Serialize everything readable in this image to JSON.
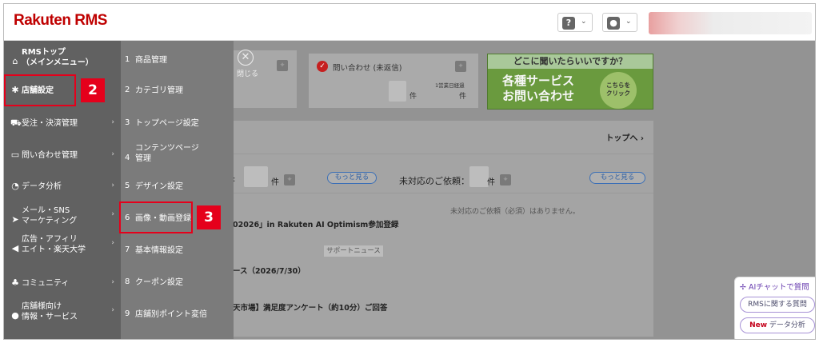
{
  "header": {
    "logo": "Rakuten RMS",
    "help_icon": "?",
    "user_icon": "person-icon",
    "chevron": "⌄"
  },
  "dashboard": {
    "close_label": "閉じる",
    "inquiry_title": "問い合わせ (未返信)",
    "inquiry_unit": "件",
    "inquiry_sub_label": "1営業日経過",
    "inquiry_sub_unit": "件",
    "help_question": "どこに聞いたらいいですか？",
    "help_line1": "各種サービス",
    "help_line2": "お問い合わせ",
    "help_click1": "こちらを",
    "help_click2": "クリック",
    "top_link": "トップへ ›",
    "count_unit": "件",
    "more_label": "もっと見る",
    "pending_label": "未対応のご依頼：",
    "pending_unit": "件",
    "no_request_text": "未対応のご依頼（必須）はありません。",
    "news1": "02026」in Rakuten AI Optimism参加登録",
    "news_badge": "サポートニュース",
    "news2": "ース（2026/7/30）",
    "news3": "天市場】満足度アンケート（約10分）ご回答"
  },
  "menu_primary": [
    {
      "icon": "home-icon",
      "glyph": "⌂",
      "label": "RMSトップ\n（メインメニュー）",
      "arrow": ""
    },
    {
      "icon": "gear-icon",
      "glyph": "✱",
      "label": "店舗設定",
      "arrow": ""
    },
    {
      "icon": "cart-icon",
      "glyph": "⛟",
      "label": "受注・決済管理",
      "arrow": "›"
    },
    {
      "icon": "chat-icon",
      "glyph": "▭",
      "label": "問い合わせ管理",
      "arrow": "›"
    },
    {
      "icon": "chart-pie-icon",
      "glyph": "◔",
      "label": "データ分析",
      "arrow": "›"
    },
    {
      "icon": "send-icon",
      "glyph": "➤",
      "label": "メール・SNS\nマーケティング",
      "arrow": "›"
    },
    {
      "icon": "megaphone-icon",
      "glyph": "◀",
      "label": "広告・アフィリ\nエイト・楽天大学",
      "arrow": "›"
    },
    {
      "icon": "people-icon",
      "glyph": "♣",
      "label": "コミュニティ",
      "arrow": "›"
    },
    {
      "icon": "info-circle-icon",
      "glyph": "●",
      "label": "店舗様向け\n情報・サービス",
      "arrow": "›"
    }
  ],
  "menu_secondary": [
    {
      "num": "1",
      "label": "商品管理"
    },
    {
      "num": "2",
      "label": "カテゴリ管理"
    },
    {
      "num": "3",
      "label": "トップページ設定"
    },
    {
      "num": "4",
      "label": "コンテンツページ\n管理"
    },
    {
      "num": "5",
      "label": "デザイン設定"
    },
    {
      "num": "6",
      "label": "画像・動画登録"
    },
    {
      "num": "7",
      "label": "基本情報設定"
    },
    {
      "num": "8",
      "label": "クーポン設定"
    },
    {
      "num": "9",
      "label": "店舗別ポイント変倍"
    }
  ],
  "step_badges": {
    "first": "2",
    "second": "3"
  },
  "ai_widget": {
    "title": "AIチャットで質問",
    "btn1": "RMSに関する質問",
    "btn2_new": "New",
    "btn2_rest": " データ分析"
  },
  "colors": {
    "brand": "#bf0000",
    "highlight": "#e5001b",
    "help_green": "#6a9a3e"
  }
}
